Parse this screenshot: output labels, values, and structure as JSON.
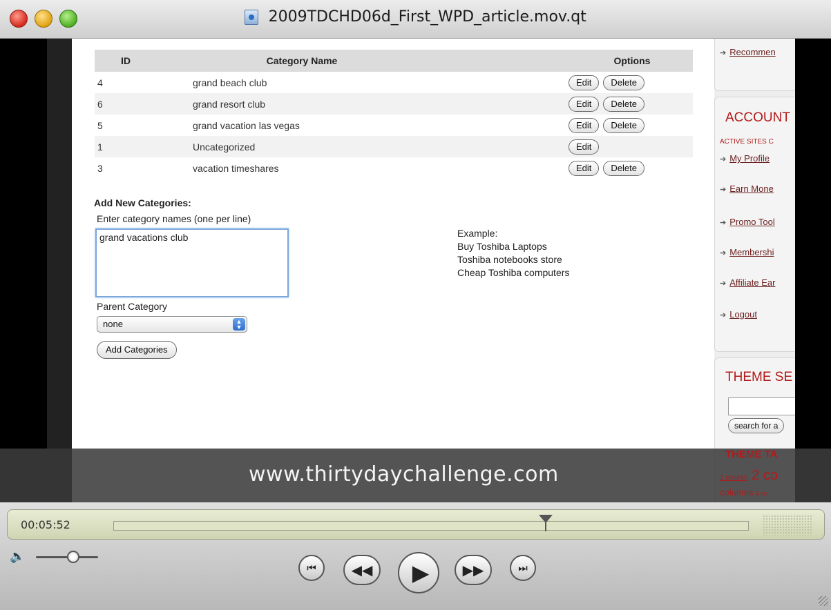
{
  "window": {
    "title": "2009TDCHD06d_First_WPD_article.mov.qt"
  },
  "table": {
    "headers": {
      "id": "ID",
      "name": "Category Name",
      "options": "Options"
    },
    "rows": [
      {
        "id": "4",
        "name": "grand beach club",
        "edit": "Edit",
        "delete": "Delete"
      },
      {
        "id": "6",
        "name": "grand resort club",
        "edit": "Edit",
        "delete": "Delete"
      },
      {
        "id": "5",
        "name": "grand vacation las vegas",
        "edit": "Edit",
        "delete": "Delete"
      },
      {
        "id": "1",
        "name": "Uncategorized",
        "edit": "Edit",
        "delete": ""
      },
      {
        "id": "3",
        "name": "vacation timeshares",
        "edit": "Edit",
        "delete": "Delete"
      }
    ]
  },
  "form": {
    "heading": "Add New Categories:",
    "enter_label": "Enter category names (one per line)",
    "textarea_value": "grand vacations club",
    "example_lines": [
      "Example:",
      "Buy Toshiba Laptops",
      "Toshiba notebooks store",
      "Cheap Toshiba computers"
    ],
    "parent_label": "Parent Category",
    "parent_value": "none",
    "submit_label": "Add Categories"
  },
  "sidebar": {
    "top_link": "Recommen",
    "account_heading": "ACCOUNT",
    "active_sites": "ACTIVE SITES C",
    "links": [
      "My Profile",
      "Earn Mone",
      "Promo Tool",
      "Membershi",
      "Affiliate Ear",
      "Logout"
    ],
    "theme_search_heading": "THEME SE",
    "search_button": "search for a",
    "theme_tags_heading": "THEME TA",
    "tag_1": "1 column",
    "tag_2": "2 co",
    "tag_3": "columns",
    "tag_4": "4 co"
  },
  "overlay": {
    "url": "www.thirtydaychallenge.com"
  },
  "player": {
    "timecode": "00:05:52",
    "progress_fraction": 0.68,
    "volume_fraction": 0.6,
    "accent_lcd": "#cfd5b3"
  }
}
